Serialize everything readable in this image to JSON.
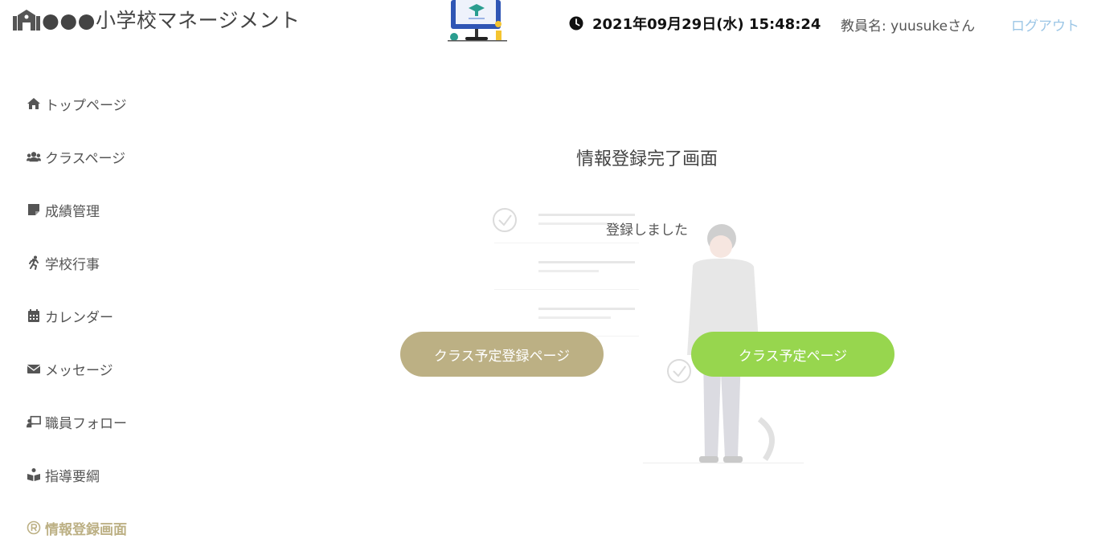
{
  "header": {
    "app_title": "●●●小学校マネージメント",
    "datetime": "2021年09月29日(水) 15:48:24",
    "teacher_label": "教員名: yuusukeさん",
    "logout_label": "ログアウト"
  },
  "sidebar": {
    "items": [
      {
        "label": "トップページ",
        "icon": "home-icon"
      },
      {
        "label": "クラスページ",
        "icon": "users-icon"
      },
      {
        "label": "成績管理",
        "icon": "sticky-note-icon"
      },
      {
        "label": "学校行事",
        "icon": "running-icon"
      },
      {
        "label": "カレンダー",
        "icon": "calendar-icon"
      },
      {
        "label": "メッセージ",
        "icon": "envelope-icon"
      },
      {
        "label": "職員フォロー",
        "icon": "chalkboard-teacher-icon"
      },
      {
        "label": "指導要綱",
        "icon": "book-reader-icon"
      },
      {
        "label": "情報登録画面",
        "icon": "registered-icon",
        "active": true
      }
    ]
  },
  "main": {
    "title": "情報登録完了画面",
    "message": "登録しました",
    "register_button_label": "クラス予定登録ページ",
    "schedule_button_label": "クラス予定ページ"
  },
  "colors": {
    "accent_olive": "#bcb084",
    "accent_green": "#97d64e",
    "logout_blue": "#9cc6e6"
  }
}
